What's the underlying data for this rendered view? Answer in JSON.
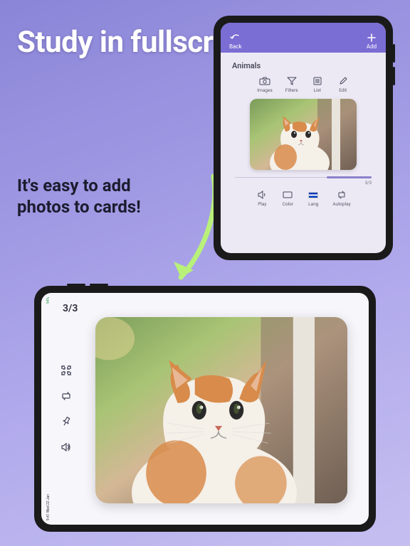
{
  "headline": "Study in fullscreen mode",
  "subhead": "It's easy to add photos to cards!",
  "portrait": {
    "back_label": "Back",
    "add_label": "Add",
    "deck_title": "Animals",
    "toolbar": {
      "images": "Images",
      "filters": "Filters",
      "list": "List",
      "edit": "Edit"
    },
    "counter": "3/3",
    "bottom": {
      "play": "Play",
      "color": "Color",
      "lang": "Lang",
      "autoplay": "Autoplay"
    }
  },
  "landscape": {
    "counter": "3/3",
    "time": "9:41 Wed 22 Jan",
    "signal": "94%"
  }
}
